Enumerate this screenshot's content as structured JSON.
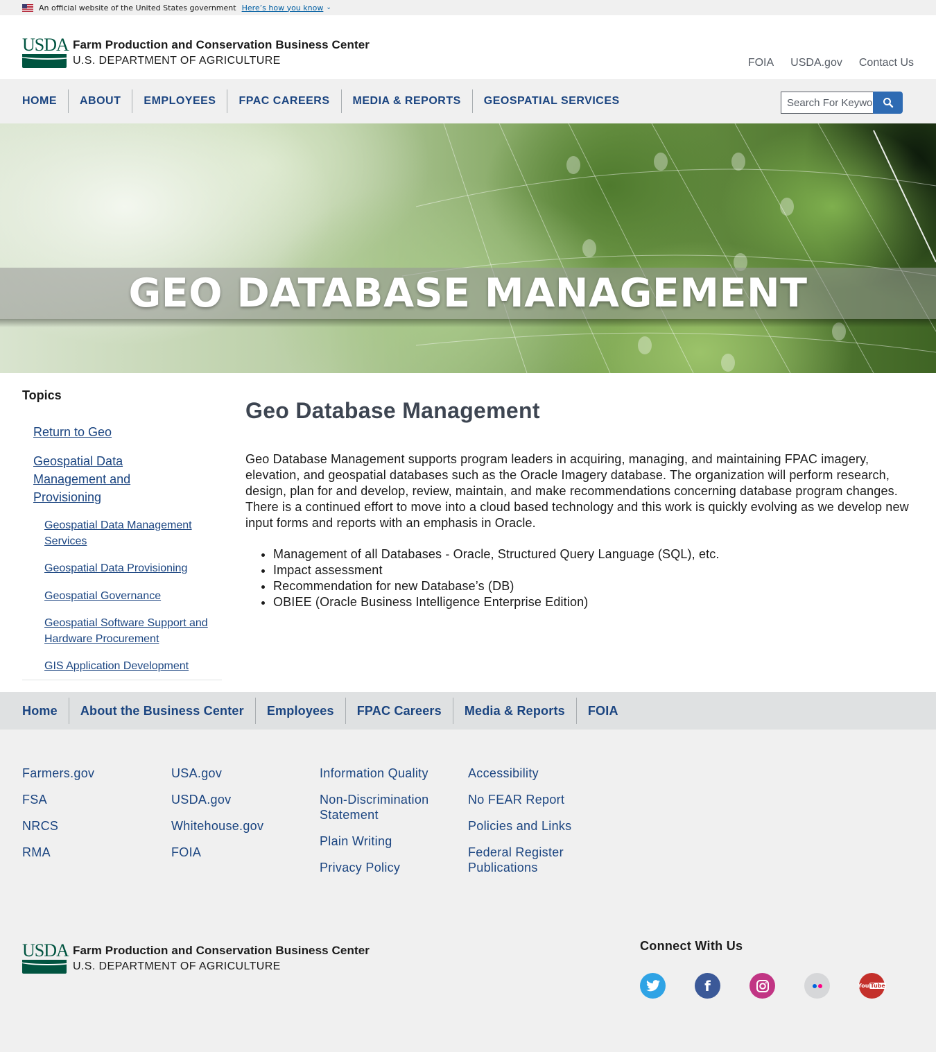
{
  "gov_banner": {
    "text": "An official website of the United States government",
    "link": "Here’s how you know"
  },
  "header": {
    "logo_text": "USDA",
    "agency_name": "Farm Production and Conservation Business Center",
    "department": "U.S. DEPARTMENT OF AGRICULTURE",
    "utility_links": [
      "FOIA",
      "USDA.gov",
      "Contact Us"
    ]
  },
  "nav": {
    "items": [
      "HOME",
      "ABOUT",
      "EMPLOYEES",
      "FPAC CAREERS",
      "MEDIA & REPORTS",
      "GEOSPATIAL SERVICES"
    ],
    "search_placeholder": "Search For Keywords"
  },
  "hero": {
    "title": "GEO DATABASE MANAGEMENT"
  },
  "sidenav": {
    "heading": "Topics",
    "links": [
      "Return to Geo",
      "Geospatial Data Management and Provisioning",
      "Geospatial Data Management Services",
      "Geospatial Data Provisioning",
      "Geospatial Governance",
      "Geospatial Software Support and Hardware Procurement",
      "GIS Application Development"
    ]
  },
  "content": {
    "title": "Geo Database Management",
    "paragraph": "Geo Database Management supports program leaders in acquiring, managing, and maintaining FPAC imagery, elevation, and geospatial databases such as the Oracle Imagery database. The organization will perform research, design, plan for and develop, review, maintain, and make recommendations concerning database program changes. There is a continued effort to move into a cloud based technology and this work is quickly evolving as we develop new input forms and reports with an emphasis in Oracle.",
    "bullets": [
      "Management of all Databases - Oracle, Structured Query Language (SQL), etc.",
      "Impact assessment",
      "Recommendation for new Database’s (DB)",
      "OBIEE (Oracle Business Intelligence Enterprise Edition)"
    ]
  },
  "footer_nav": {
    "items": [
      "Home",
      "About the Business Center",
      "Employees",
      "FPAC Careers",
      "Media & Reports",
      "FOIA"
    ]
  },
  "footer": {
    "columns": [
      [
        "Farmers.gov",
        "FSA",
        "NRCS",
        "RMA"
      ],
      [
        "USA.gov",
        "USDA.gov",
        "Whitehouse.gov",
        "FOIA"
      ],
      [
        "Information Quality",
        "Non-Discrimination Statement",
        "Plain Writing",
        "Privacy Policy"
      ],
      [
        "Accessibility",
        "No FEAR Report",
        "Policies and Links",
        "Federal Register Publications"
      ]
    ],
    "connect_heading": "Connect With Us",
    "social": [
      {
        "icon": "twitter-icon",
        "color": "#2fa3e5"
      },
      {
        "icon": "facebook-icon",
        "color": "#3b5998"
      },
      {
        "icon": "instagram-icon",
        "color": "#c13584"
      },
      {
        "icon": "flickr-icon",
        "color": "#d6d7d9"
      },
      {
        "icon": "youtube-icon",
        "color": "#c4302b"
      }
    ]
  }
}
